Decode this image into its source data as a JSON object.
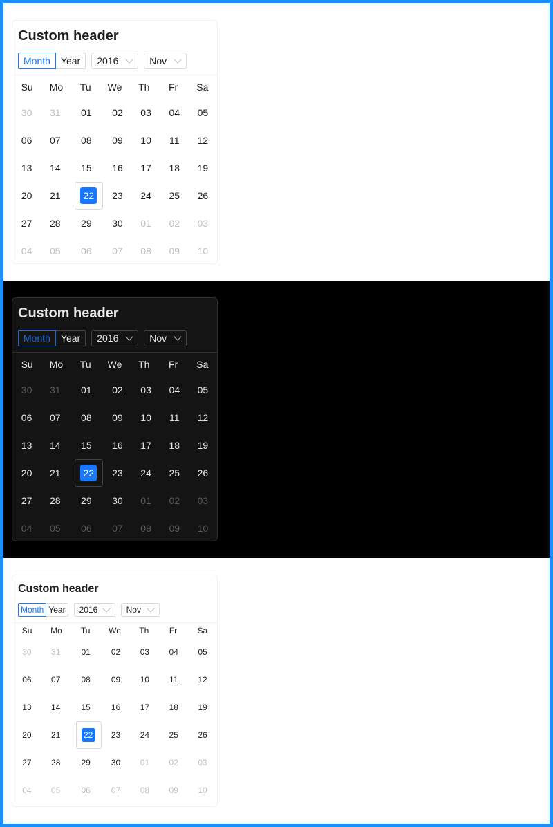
{
  "calendar": {
    "title": "Custom header",
    "mode_month": "Month",
    "mode_year": "Year",
    "year_value": "2016",
    "month_value": "Nov",
    "weekdays": [
      "Su",
      "Mo",
      "Tu",
      "We",
      "Th",
      "Fr",
      "Sa"
    ],
    "weeks": [
      [
        "30",
        "31",
        "01",
        "02",
        "03",
        "04",
        "05"
      ],
      [
        "06",
        "07",
        "08",
        "09",
        "10",
        "11",
        "12"
      ],
      [
        "13",
        "14",
        "15",
        "16",
        "17",
        "18",
        "19"
      ],
      [
        "20",
        "21",
        "22",
        "23",
        "24",
        "25",
        "26"
      ],
      [
        "27",
        "28",
        "29",
        "30",
        "01",
        "02",
        "03"
      ],
      [
        "04",
        "05",
        "06",
        "07",
        "08",
        "09",
        "10"
      ]
    ],
    "selected_date": "22",
    "colors": {
      "accent": "#1677ff",
      "frame": "#1890ff"
    }
  }
}
